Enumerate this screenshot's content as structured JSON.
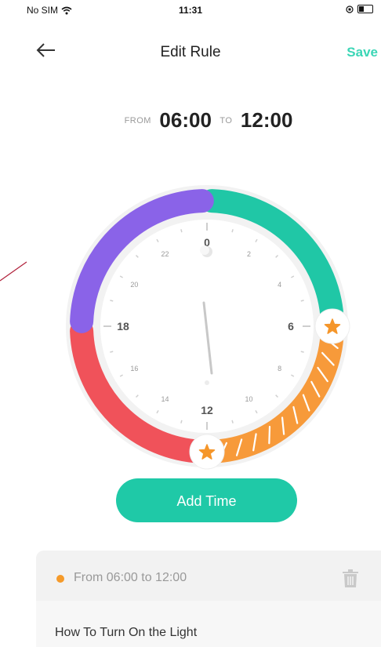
{
  "status_bar": {
    "carrier": "No SIM",
    "time": "11:31"
  },
  "header": {
    "title": "Edit Rule",
    "save_label": "Save"
  },
  "time_range": {
    "from_label": "FROM",
    "from": "06:00",
    "to_label": "TO",
    "to": "12:00"
  },
  "clock": {
    "hour_labels": [
      "0",
      "2",
      "4",
      "6",
      "8",
      "10",
      "12",
      "14",
      "16",
      "18",
      "20",
      "22"
    ],
    "segments": [
      {
        "from_hour": 0,
        "to_hour": 6,
        "color": "#20c7a6"
      },
      {
        "from_hour": 6,
        "to_hour": 12,
        "color": "#f79a3a"
      },
      {
        "from_hour": 12,
        "to_hour": 18,
        "color": "#f0525a"
      },
      {
        "from_hour": 18,
        "to_hour": 24,
        "color": "#8a63e8"
      }
    ],
    "selected_from_hour": 6,
    "selected_to_hour": 12,
    "handle_icon": "star-icon",
    "center_icon": "moon-icon"
  },
  "add_time_label": "Add Time",
  "rule": {
    "range_text": "From 06:00 to 12:00",
    "dot_color": "#f59a2a",
    "delete_icon": "trash-icon",
    "section_title": "How To Turn On the Light"
  },
  "colors": {
    "accent": "#1fc9a7",
    "save": "#3bd6b6"
  }
}
